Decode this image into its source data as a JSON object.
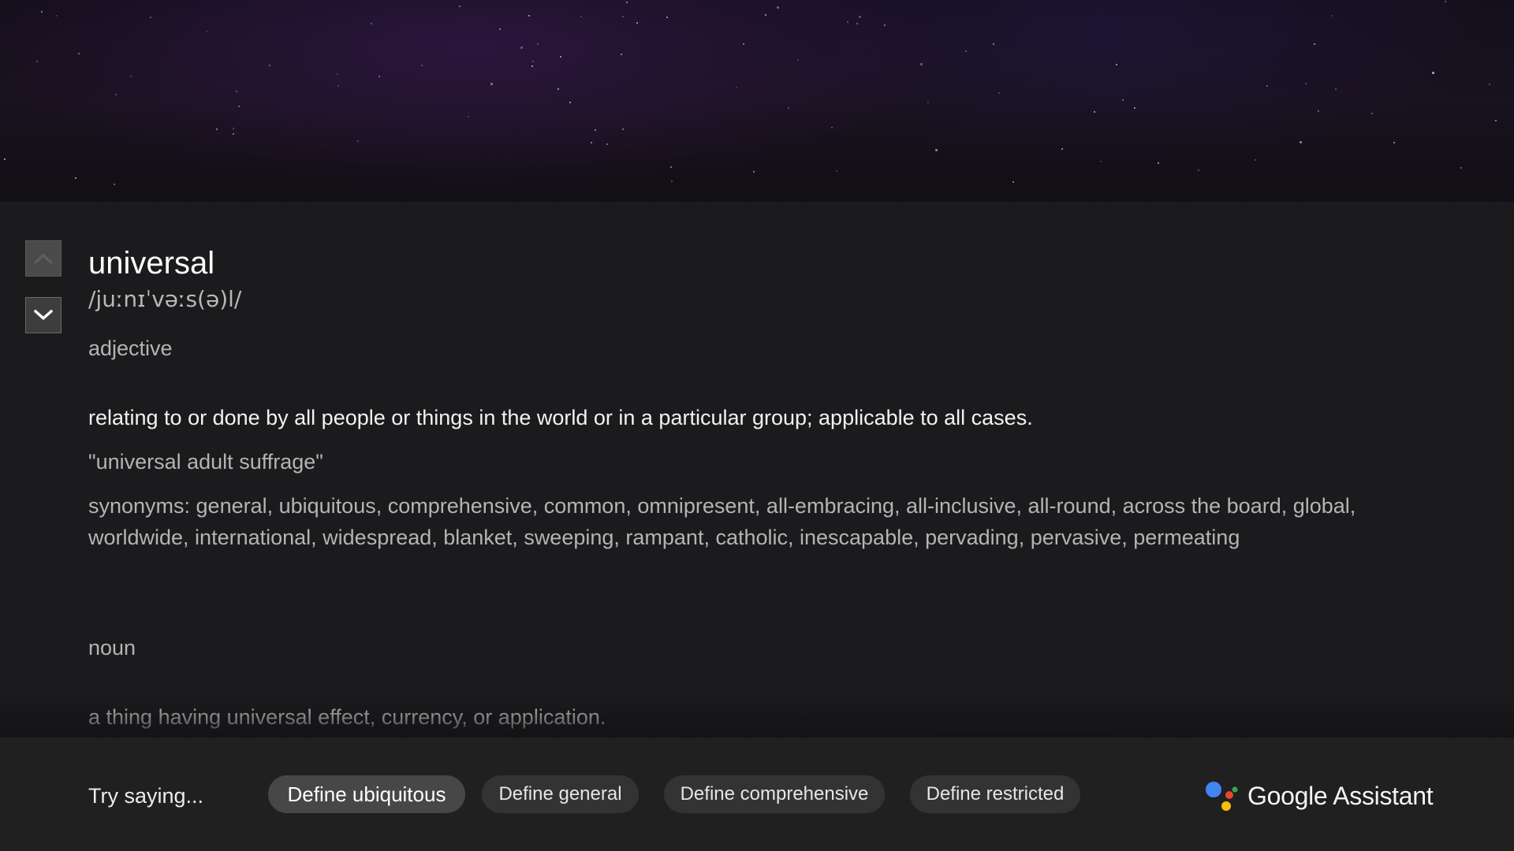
{
  "entry": {
    "word": "universal",
    "phonetic": "/juːnɪˈvəːs(ə)l/",
    "senses": [
      {
        "part_of_speech": "adjective",
        "definition": "relating to or done by all people or things in the world or in a particular group; applicable to all cases.",
        "example": "\"universal adult suffrage\"",
        "synonyms": "synonyms: general, ubiquitous, comprehensive, common, omnipresent, all-embracing, all-inclusive, all-round, across the board, global, worldwide, international, widespread, blanket, sweeping, rampant, catholic, inescapable, pervading, pervasive, permeating"
      },
      {
        "part_of_speech": "noun",
        "definition": "a thing having universal effect, currency, or application."
      }
    ]
  },
  "scroll_controls": {
    "up_icon": "chevron-up-icon",
    "down_icon": "chevron-down-icon"
  },
  "suggestions": {
    "prompt": "Try saying...",
    "chips": [
      {
        "label": "Define ubiquitous",
        "focused": true
      },
      {
        "label": "Define general",
        "focused": false
      },
      {
        "label": "Define comprehensive",
        "focused": false
      },
      {
        "label": "Define restricted",
        "focused": false
      }
    ]
  },
  "branding": {
    "name": "Google Assistant",
    "icon": "google-assistant-dots-icon",
    "dot_colors": [
      "#4285F4",
      "#EA4335",
      "#FBBC05",
      "#34A853"
    ]
  }
}
